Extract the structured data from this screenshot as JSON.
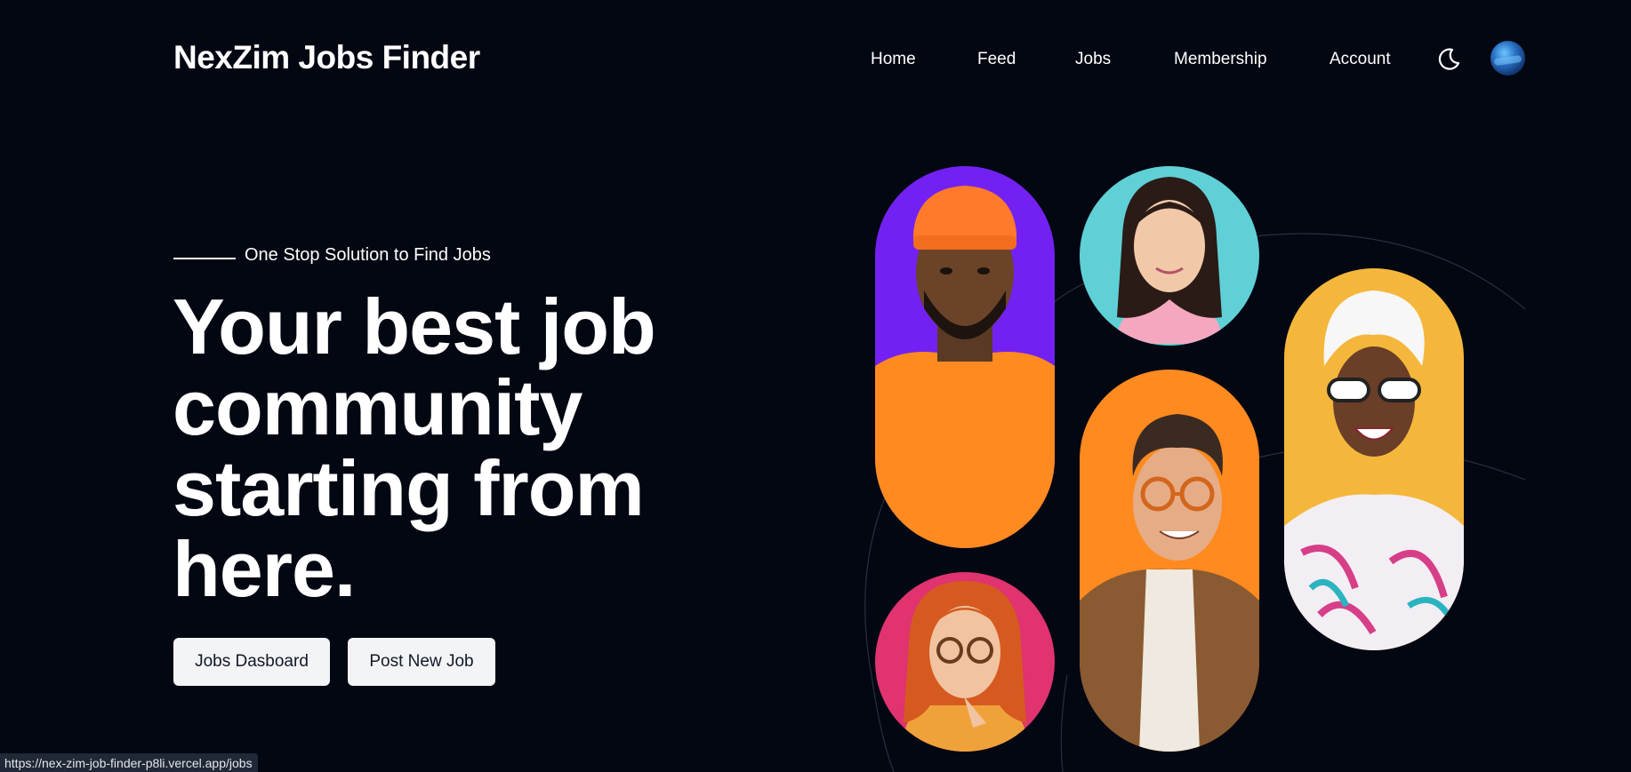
{
  "header": {
    "brand": "NexZim Jobs Finder",
    "nav": [
      {
        "label": "Home"
      },
      {
        "label": "Feed"
      },
      {
        "label": "Jobs"
      },
      {
        "label": "Membership"
      },
      {
        "label": "Account"
      }
    ],
    "theme_icon": "moon-icon",
    "avatar_icon": "user-avatar"
  },
  "hero": {
    "tagline": "One Stop Solution to Find Jobs",
    "headline": "Your best job community starting from here.",
    "buttons": {
      "dashboard": "Jobs Dasboard",
      "post": "Post New Job"
    }
  },
  "status_bar": {
    "url": "https://nex-zim-job-finder-p8li.vercel.app/jobs"
  },
  "colors": {
    "background": "#030712",
    "purple": "#7321f2",
    "cyan": "#5fd0d6",
    "orange": "#ff8a1f",
    "yellow": "#f4b73c",
    "pink": "#e0336f"
  }
}
